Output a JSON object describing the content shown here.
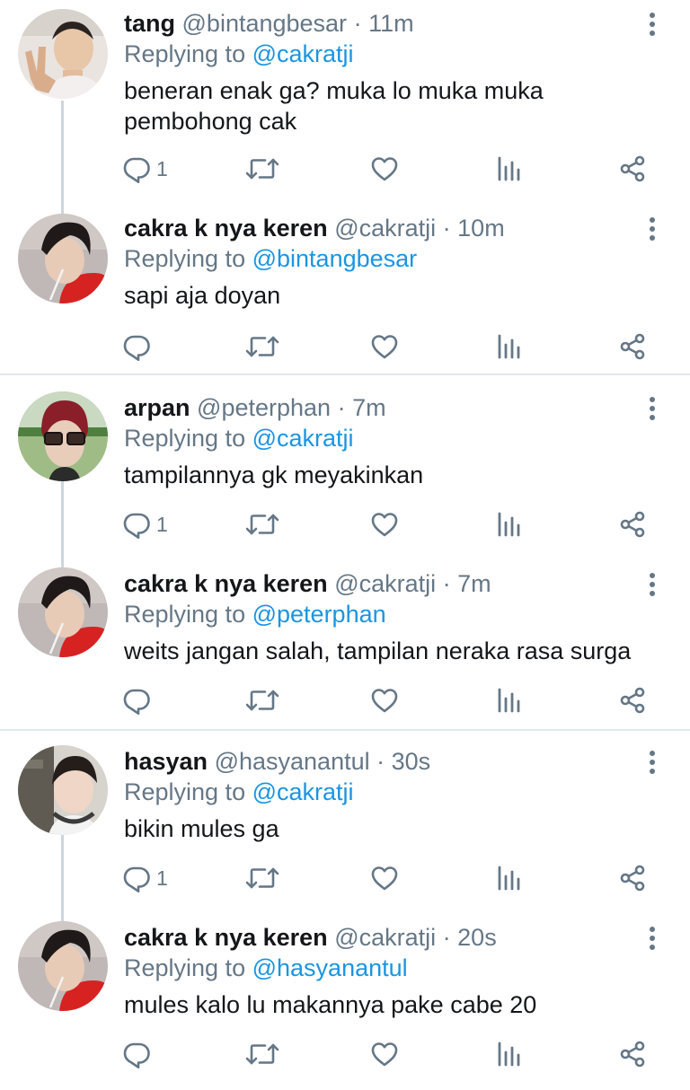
{
  "threads": [
    {
      "tweets": [
        {
          "name": "tang",
          "handle": "@bintangbesar",
          "dot": "·",
          "time": "11m",
          "replying_prefix": "Replying to",
          "replying_to": "@cakratji",
          "body": "beneran enak ga? muka lo muka muka pembohong cak",
          "reply_count": "1",
          "avatar": "avatar-photo-rock-hand"
        },
        {
          "name": "cakra k nya keren",
          "handle": "@cakratji",
          "dot": "·",
          "time": "10m",
          "replying_prefix": "Replying to",
          "replying_to": "@bintangbesar",
          "body": "sapi aja doyan",
          "reply_count": "",
          "avatar": "avatar-photo-straw"
        }
      ]
    },
    {
      "tweets": [
        {
          "name": "arpan",
          "handle": "@peterphan",
          "dot": "·",
          "time": "7m",
          "replying_prefix": "Replying to",
          "replying_to": "@cakratji",
          "body": "tampilannya gk meyakinkan",
          "reply_count": "1",
          "avatar": "avatar-photo-glasses"
        },
        {
          "name": "cakra k nya keren",
          "handle": "@cakratji",
          "dot": "·",
          "time": "7m",
          "replying_prefix": "Replying to",
          "replying_to": "@peterphan",
          "body": "weits jangan salah, tampilan neraka rasa surga",
          "reply_count": "",
          "avatar": "avatar-photo-straw"
        }
      ]
    },
    {
      "tweets": [
        {
          "name": "hasyan",
          "handle": "@hasyanantul",
          "dot": "·",
          "time": "30s",
          "replying_prefix": "Replying to",
          "replying_to": "@cakratji",
          "body": "bikin mules ga",
          "reply_count": "1",
          "avatar": "avatar-photo-headphones"
        },
        {
          "name": "cakra k nya keren",
          "handle": "@cakratji",
          "dot": "·",
          "time": "20s",
          "replying_prefix": "Replying to",
          "replying_to": "@hasyanantul",
          "body": "mules kalo lu makannya pake cabe 20",
          "reply_count": "",
          "avatar": "avatar-photo-straw"
        }
      ]
    }
  ],
  "icons": {
    "reply": "reply-icon",
    "retweet": "retweet-icon",
    "like": "heart-icon",
    "analytics": "analytics-icon",
    "share": "share-icon",
    "more": "more-vertical-icon"
  },
  "colors": {
    "text": "#14171a",
    "secondary": "#657786",
    "link": "#1b95e0",
    "icon": "#657786",
    "thread_line": "#ccd6dd",
    "separator": "#e1e8ed"
  }
}
